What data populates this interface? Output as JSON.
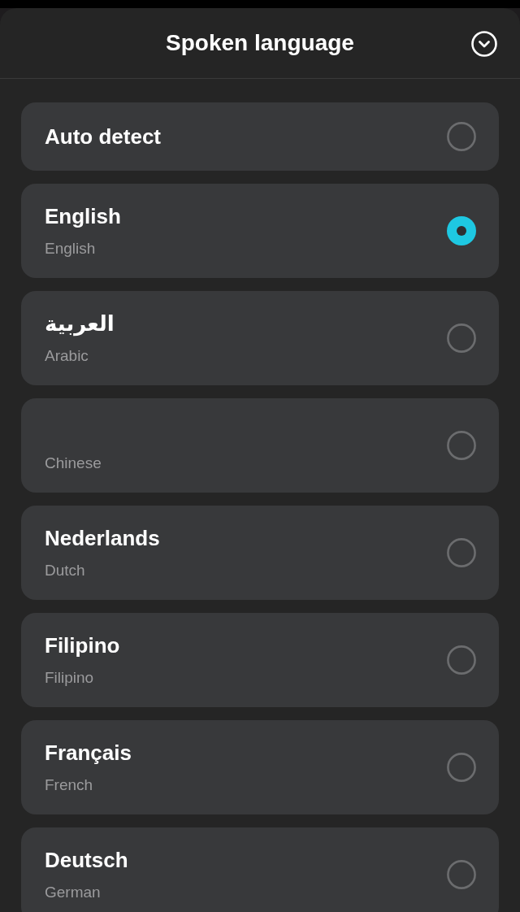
{
  "sheet": {
    "title": "Spoken language"
  },
  "options": [
    {
      "title": "Auto detect",
      "selected": false
    },
    {
      "title": "English",
      "subtitle": "English",
      "selected": true
    },
    {
      "title": "العربية",
      "subtitle": "Arabic",
      "selected": false
    },
    {
      "subtitle": "Chinese",
      "selected": false
    },
    {
      "title": "Nederlands",
      "subtitle": "Dutch",
      "selected": false
    },
    {
      "title": "Filipino",
      "subtitle": "Filipino",
      "selected": false
    },
    {
      "title": "Français",
      "subtitle": "French",
      "selected": false
    },
    {
      "title": "Deutsch",
      "subtitle": "German",
      "selected": false
    }
  ]
}
